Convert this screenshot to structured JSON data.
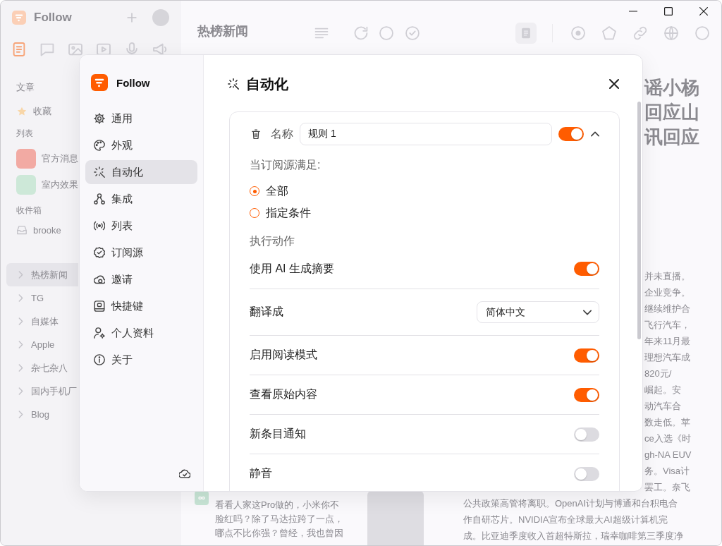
{
  "sidebar": {
    "app_name": "Follow",
    "views": [
      {
        "selected": true
      },
      {
        "selected": false
      },
      {
        "selected": false
      },
      {
        "selected": false
      },
      {
        "selected": false
      },
      {
        "selected": false
      }
    ],
    "view_title": "文章",
    "starred": {
      "label": "收藏"
    },
    "lists": {
      "title": "列表",
      "items": [
        {
          "label": "官方消息",
          "color": "#f2aaa3"
        },
        {
          "label": "室内效果",
          "color": "#cde8d8"
        }
      ]
    },
    "inbox": {
      "title": "收件箱",
      "items": [
        {
          "label": "brooke"
        }
      ]
    },
    "folders": [
      {
        "label": "热榜新闻",
        "selected": true
      },
      {
        "label": "TG",
        "selected": false
      },
      {
        "label": "自媒体",
        "selected": false
      },
      {
        "label": "Apple",
        "selected": false
      },
      {
        "label": "杂七杂八",
        "selected": false
      },
      {
        "label": "国内手机厂",
        "selected": false
      },
      {
        "label": "Blog",
        "selected": false
      }
    ]
  },
  "timeline": {
    "title": "热榜新闻",
    "entry": {
      "lines": [
        "看看人家这Pro做的，小米你不",
        "脸红吗？除了马达拉跨了一点，",
        "哪点不比你强？曾经，我也曾因"
      ]
    },
    "article": {
      "headline": [
        "谣小杨",
        "回应山",
        "讯回应"
      ],
      "cut_lines": [
        "并未直播。",
        "企业竞争。",
        "继续维护合",
        "飞行汽车，",
        "年来11月最",
        "理想汽车成",
        "820元/",
        "崛起。安",
        "动汽车合",
        "数走低。苹",
        "ce入选《时",
        "gh-NA EUV",
        "务。Visa计",
        "罢工。奈飞"
      ],
      "lines": [
        "公共政策高管将离职。OpenAI计划与博通和台积电合",
        "作自研芯片。NVIDIA宣布全球最大AI超级计算机完",
        "成。比亚迪季度收入首超特斯拉，瑞幸咖啡第三季度净"
      ]
    }
  },
  "settings": {
    "brand": "Follow",
    "nav": [
      {
        "label": "通用",
        "selected": false
      },
      {
        "label": "外观",
        "selected": false
      },
      {
        "label": "自动化",
        "selected": true
      },
      {
        "label": "集成",
        "selected": false
      },
      {
        "label": "列表",
        "selected": false
      },
      {
        "label": "订阅源",
        "selected": false
      },
      {
        "label": "邀请",
        "selected": false
      },
      {
        "label": "快捷键",
        "selected": false
      },
      {
        "label": "个人资料",
        "selected": false
      },
      {
        "label": "关于",
        "selected": false
      }
    ],
    "title": "自动化",
    "rule": {
      "name_label": "名称",
      "name": "规则 1",
      "enabled": true,
      "expanded": true,
      "condition_title": "当订阅源满足:",
      "conditions": [
        {
          "label": "全部",
          "selected": true
        },
        {
          "label": "指定条件",
          "selected": false
        }
      ],
      "actions_title": "执行动作",
      "actions": [
        {
          "kind": "toggle",
          "label": "使用 AI 生成摘要",
          "on": true
        },
        {
          "kind": "select",
          "label": "翻译成",
          "value": "简体中文"
        },
        {
          "kind": "toggle",
          "label": "启用阅读模式",
          "on": true
        },
        {
          "kind": "toggle",
          "label": "查看原始内容",
          "on": true
        },
        {
          "kind": "toggle",
          "label": "新条目通知",
          "on": false
        },
        {
          "kind": "toggle",
          "label": "静音",
          "on": false
        }
      ]
    }
  }
}
